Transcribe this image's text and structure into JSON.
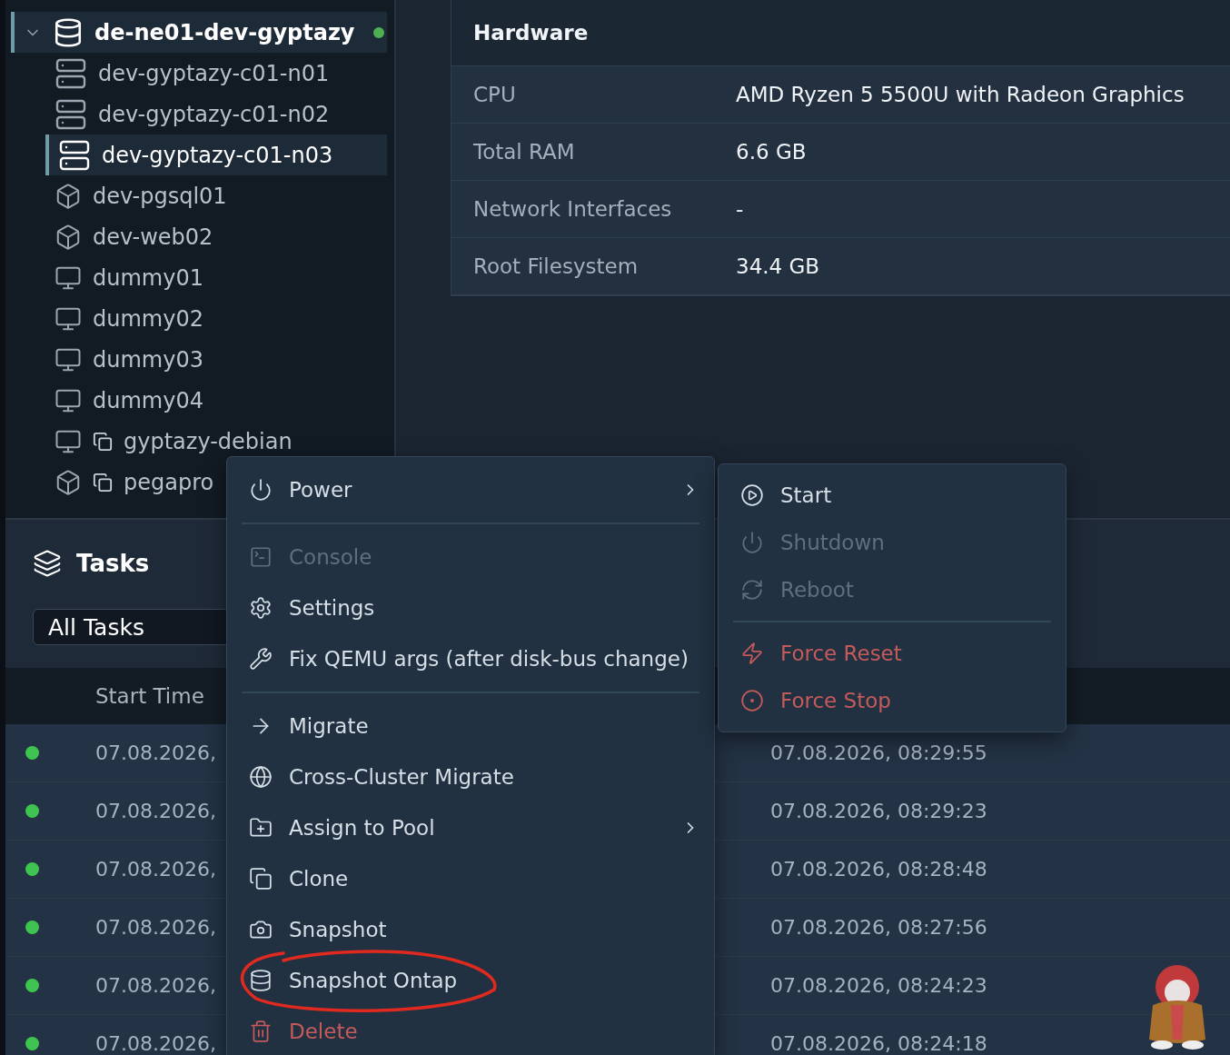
{
  "sidebar": {
    "tree": [
      {
        "label": "de-ne01-dev-gyptazy",
        "kind": "cluster",
        "expanded": true,
        "selected": true,
        "color": "#4caf50",
        "children": [
          {
            "label": "dev-gyptazy-c01-n01",
            "kind": "node",
            "selected": false,
            "template": false
          },
          {
            "label": "dev-gyptazy-c01-n02",
            "kind": "node",
            "selected": false,
            "template": false
          },
          {
            "label": "dev-gyptazy-c01-n03",
            "kind": "node",
            "selected": true,
            "template": false
          },
          {
            "label": "dev-pgsql01",
            "kind": "container",
            "selected": false,
            "template": false
          },
          {
            "label": "dev-web02",
            "kind": "container",
            "selected": false,
            "template": false
          },
          {
            "label": "dummy01",
            "kind": "vm",
            "selected": false,
            "template": false
          },
          {
            "label": "dummy02",
            "kind": "vm",
            "selected": false,
            "template": false
          },
          {
            "label": "dummy03",
            "kind": "vm",
            "selected": false,
            "template": false
          },
          {
            "label": "dummy04",
            "kind": "vm",
            "selected": false,
            "template": false
          },
          {
            "label": "gyptazy-debian",
            "kind": "vm",
            "selected": false,
            "template": true
          },
          {
            "label": "pegapro",
            "kind": "container",
            "selected": false,
            "template": true
          }
        ]
      }
    ]
  },
  "hardware": {
    "title": "Hardware",
    "rows": [
      {
        "label": "CPU",
        "value": "AMD Ryzen 5 5500U with Radeon Graphics"
      },
      {
        "label": "Total RAM",
        "value": "6.6 GB"
      },
      {
        "label": "Network Interfaces",
        "value": "-"
      },
      {
        "label": "Root Filesystem",
        "value": "34.4 GB"
      }
    ]
  },
  "tasks": {
    "title": "Tasks",
    "filter": {
      "value": "All Tasks"
    },
    "table": {
      "columns": [
        "Start Time"
      ],
      "rows": [
        {
          "color": "#3fc452",
          "start_time": "07.08.2026,",
          "column_3": "07.08.2026, 08:29:55"
        },
        {
          "color": "#3fc452",
          "start_time": "07.08.2026,",
          "column_3": "07.08.2026, 08:29:23"
        },
        {
          "color": "#3fc452",
          "start_time": "07.08.2026,",
          "column_3": "07.08.2026, 08:28:48"
        },
        {
          "color": "#3fc452",
          "start_time": "07.08.2026,",
          "column_3": "07.08.2026, 08:27:56"
        },
        {
          "color": "#3fc452",
          "start_time": "07.08.2026,",
          "column_3": "07.08.2026, 08:24:23"
        },
        {
          "color": "#3fc452",
          "start_time": "07.08.2026,",
          "column_3": "07.08.2026, 08:24:18"
        }
      ]
    }
  },
  "context_menu": {
    "items": [
      {
        "kind": "item",
        "label": "Power",
        "disabled": false,
        "submenu": true,
        "circled": false
      },
      {
        "kind": "separator"
      },
      {
        "kind": "item",
        "label": "Console",
        "disabled": true,
        "submenu": false,
        "circled": false
      },
      {
        "kind": "item",
        "label": "Settings",
        "disabled": false,
        "submenu": false,
        "circled": false
      },
      {
        "kind": "item",
        "label": "Fix QEMU args (after disk-bus change)",
        "disabled": false,
        "submenu": false,
        "circled": false
      },
      {
        "kind": "separator"
      },
      {
        "kind": "item",
        "label": "Migrate",
        "disabled": false,
        "submenu": false,
        "circled": false
      },
      {
        "kind": "item",
        "label": "Cross-Cluster Migrate",
        "disabled": false,
        "submenu": false,
        "circled": false
      },
      {
        "kind": "item",
        "label": "Assign to Pool",
        "disabled": false,
        "submenu": true,
        "circled": false
      },
      {
        "kind": "item",
        "label": "Clone",
        "disabled": false,
        "submenu": false,
        "circled": false
      },
      {
        "kind": "item",
        "label": "Snapshot",
        "disabled": false,
        "submenu": false,
        "circled": false
      },
      {
        "kind": "item",
        "label": "Snapshot Ontap",
        "disabled": false,
        "submenu": false,
        "circled": true
      },
      {
        "kind": "danger",
        "label": "Delete",
        "disabled": false,
        "submenu": false,
        "circled": false
      }
    ]
  },
  "power_submenu": {
    "items": [
      {
        "kind": "item",
        "label": "Start",
        "disabled": false
      },
      {
        "kind": "item",
        "label": "Shutdown",
        "disabled": true
      },
      {
        "kind": "item",
        "label": "Reboot",
        "disabled": true
      },
      {
        "kind": "separator"
      },
      {
        "kind": "danger",
        "label": "Force Reset",
        "disabled": false
      },
      {
        "kind": "danger",
        "label": "Force Stop",
        "disabled": false
      }
    ]
  }
}
